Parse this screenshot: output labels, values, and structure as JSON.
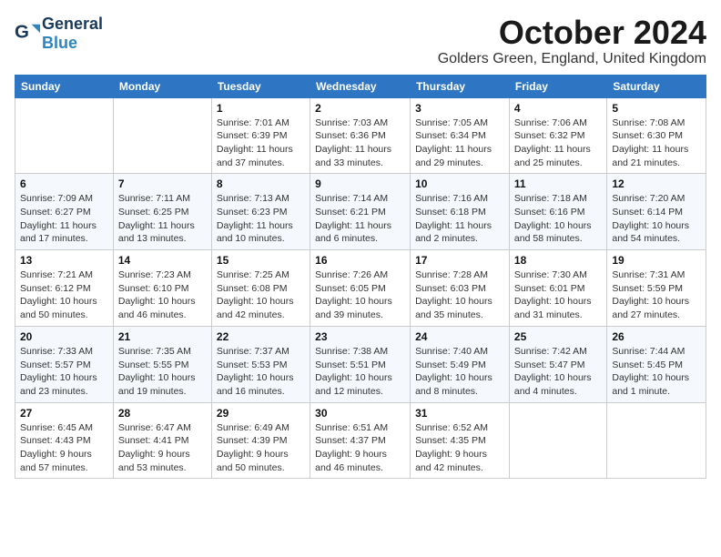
{
  "logo": {
    "general": "General",
    "blue": "Blue"
  },
  "header": {
    "month": "October 2024",
    "location": "Golders Green, England, United Kingdom"
  },
  "weekdays": [
    "Sunday",
    "Monday",
    "Tuesday",
    "Wednesday",
    "Thursday",
    "Friday",
    "Saturday"
  ],
  "weeks": [
    [
      {
        "day": "",
        "info": ""
      },
      {
        "day": "",
        "info": ""
      },
      {
        "day": "1",
        "info": "Sunrise: 7:01 AM\nSunset: 6:39 PM\nDaylight: 11 hours and 37 minutes."
      },
      {
        "day": "2",
        "info": "Sunrise: 7:03 AM\nSunset: 6:36 PM\nDaylight: 11 hours and 33 minutes."
      },
      {
        "day": "3",
        "info": "Sunrise: 7:05 AM\nSunset: 6:34 PM\nDaylight: 11 hours and 29 minutes."
      },
      {
        "day": "4",
        "info": "Sunrise: 7:06 AM\nSunset: 6:32 PM\nDaylight: 11 hours and 25 minutes."
      },
      {
        "day": "5",
        "info": "Sunrise: 7:08 AM\nSunset: 6:30 PM\nDaylight: 11 hours and 21 minutes."
      }
    ],
    [
      {
        "day": "6",
        "info": "Sunrise: 7:09 AM\nSunset: 6:27 PM\nDaylight: 11 hours and 17 minutes."
      },
      {
        "day": "7",
        "info": "Sunrise: 7:11 AM\nSunset: 6:25 PM\nDaylight: 11 hours and 13 minutes."
      },
      {
        "day": "8",
        "info": "Sunrise: 7:13 AM\nSunset: 6:23 PM\nDaylight: 11 hours and 10 minutes."
      },
      {
        "day": "9",
        "info": "Sunrise: 7:14 AM\nSunset: 6:21 PM\nDaylight: 11 hours and 6 minutes."
      },
      {
        "day": "10",
        "info": "Sunrise: 7:16 AM\nSunset: 6:18 PM\nDaylight: 11 hours and 2 minutes."
      },
      {
        "day": "11",
        "info": "Sunrise: 7:18 AM\nSunset: 6:16 PM\nDaylight: 10 hours and 58 minutes."
      },
      {
        "day": "12",
        "info": "Sunrise: 7:20 AM\nSunset: 6:14 PM\nDaylight: 10 hours and 54 minutes."
      }
    ],
    [
      {
        "day": "13",
        "info": "Sunrise: 7:21 AM\nSunset: 6:12 PM\nDaylight: 10 hours and 50 minutes."
      },
      {
        "day": "14",
        "info": "Sunrise: 7:23 AM\nSunset: 6:10 PM\nDaylight: 10 hours and 46 minutes."
      },
      {
        "day": "15",
        "info": "Sunrise: 7:25 AM\nSunset: 6:08 PM\nDaylight: 10 hours and 42 minutes."
      },
      {
        "day": "16",
        "info": "Sunrise: 7:26 AM\nSunset: 6:05 PM\nDaylight: 10 hours and 39 minutes."
      },
      {
        "day": "17",
        "info": "Sunrise: 7:28 AM\nSunset: 6:03 PM\nDaylight: 10 hours and 35 minutes."
      },
      {
        "day": "18",
        "info": "Sunrise: 7:30 AM\nSunset: 6:01 PM\nDaylight: 10 hours and 31 minutes."
      },
      {
        "day": "19",
        "info": "Sunrise: 7:31 AM\nSunset: 5:59 PM\nDaylight: 10 hours and 27 minutes."
      }
    ],
    [
      {
        "day": "20",
        "info": "Sunrise: 7:33 AM\nSunset: 5:57 PM\nDaylight: 10 hours and 23 minutes."
      },
      {
        "day": "21",
        "info": "Sunrise: 7:35 AM\nSunset: 5:55 PM\nDaylight: 10 hours and 19 minutes."
      },
      {
        "day": "22",
        "info": "Sunrise: 7:37 AM\nSunset: 5:53 PM\nDaylight: 10 hours and 16 minutes."
      },
      {
        "day": "23",
        "info": "Sunrise: 7:38 AM\nSunset: 5:51 PM\nDaylight: 10 hours and 12 minutes."
      },
      {
        "day": "24",
        "info": "Sunrise: 7:40 AM\nSunset: 5:49 PM\nDaylight: 10 hours and 8 minutes."
      },
      {
        "day": "25",
        "info": "Sunrise: 7:42 AM\nSunset: 5:47 PM\nDaylight: 10 hours and 4 minutes."
      },
      {
        "day": "26",
        "info": "Sunrise: 7:44 AM\nSunset: 5:45 PM\nDaylight: 10 hours and 1 minute."
      }
    ],
    [
      {
        "day": "27",
        "info": "Sunrise: 6:45 AM\nSunset: 4:43 PM\nDaylight: 9 hours and 57 minutes."
      },
      {
        "day": "28",
        "info": "Sunrise: 6:47 AM\nSunset: 4:41 PM\nDaylight: 9 hours and 53 minutes."
      },
      {
        "day": "29",
        "info": "Sunrise: 6:49 AM\nSunset: 4:39 PM\nDaylight: 9 hours and 50 minutes."
      },
      {
        "day": "30",
        "info": "Sunrise: 6:51 AM\nSunset: 4:37 PM\nDaylight: 9 hours and 46 minutes."
      },
      {
        "day": "31",
        "info": "Sunrise: 6:52 AM\nSunset: 4:35 PM\nDaylight: 9 hours and 42 minutes."
      },
      {
        "day": "",
        "info": ""
      },
      {
        "day": "",
        "info": ""
      }
    ]
  ]
}
